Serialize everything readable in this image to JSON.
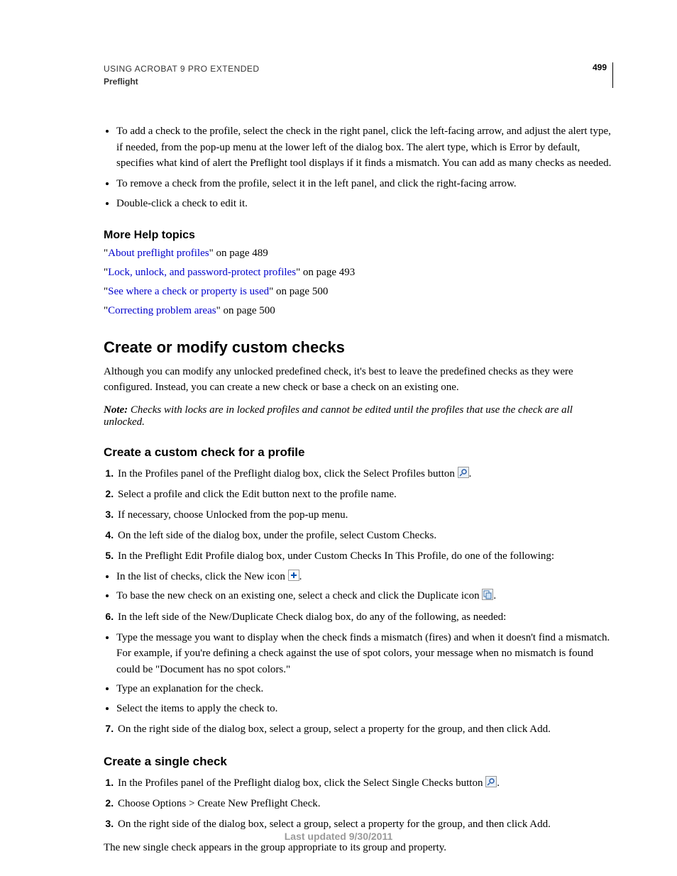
{
  "header": {
    "title_line1": "USING ACROBAT 9 PRO EXTENDED",
    "title_line2": "Preflight",
    "page_number": "499"
  },
  "intro_bullets": [
    "To add a check to the profile, select the check in the right panel, click the left-facing arrow, and adjust the alert type, if needed, from the pop-up menu at the lower left of the dialog box. The alert type, which is Error by default, specifies what kind of alert the Preflight tool displays if it finds a mismatch. You can add as many checks as needed.",
    "To remove a check from the profile, select it in the left panel, and click the right-facing arrow.",
    "Double-click a check to edit it."
  ],
  "more_help": {
    "heading": "More Help topics",
    "items": [
      {
        "link": "About preflight profiles",
        "suffix": "\" on page 489"
      },
      {
        "link": "Lock, unlock, and password-protect profiles",
        "suffix": "\" on page 493"
      },
      {
        "link": "See where a check or property is used",
        "suffix": "\" on page 500"
      },
      {
        "link": "Correcting problem areas",
        "suffix": "\" on page 500"
      }
    ]
  },
  "section": {
    "heading": "Create or modify custom checks",
    "body": "Although you can modify any unlocked predefined check, it's best to leave the predefined checks as they were configured. Instead, you can create a new check or base a check on an existing one.",
    "note_label": "Note:",
    "note_body": " Checks with locks are in locked profiles and cannot be edited until the profiles that use the check are all unlocked."
  },
  "proc1": {
    "heading": "Create a custom check for a profile",
    "steps": [
      "In the Profiles panel of the Preflight dialog box, click the Select Profiles button ",
      "Select a profile and click the Edit button next to the profile name.",
      "If necessary, choose Unlocked from the pop-up menu.",
      "On the left side of the dialog box, under the profile, select Custom Checks.",
      "In the Preflight Edit Profile dialog box, under Custom Checks In This Profile, do one of the following:"
    ],
    "sub_bullets_a": [
      "In the list of checks, click the New icon ",
      "To base the new check on an existing one, select a check and click the Duplicate icon "
    ],
    "step6": "In the left side of the New/Duplicate Check dialog box, do any of the following, as needed:",
    "sub_bullets_b": [
      "Type the message you want to display when the check finds a mismatch (fires) and when it doesn't find a mismatch. For example, if you're defining a check against the use of spot colors, your message when no mismatch is found could be \"Document has no spot colors.\"",
      "Type an explanation for the check.",
      "Select the items to apply the check to."
    ],
    "step7": "On the right side of the dialog box, select a group, select a property for the group, and then click Add."
  },
  "proc2": {
    "heading": "Create a single check",
    "steps": [
      "In the Profiles panel of the Preflight dialog box, click the Select Single Checks button ",
      "Choose Options > Create New Preflight Check.",
      "On the right side of the dialog box, select a group, select a property for the group, and then click Add."
    ],
    "after": "The new single check appears in the group appropriate to its group and property."
  },
  "footer": "Last updated 9/30/2011"
}
